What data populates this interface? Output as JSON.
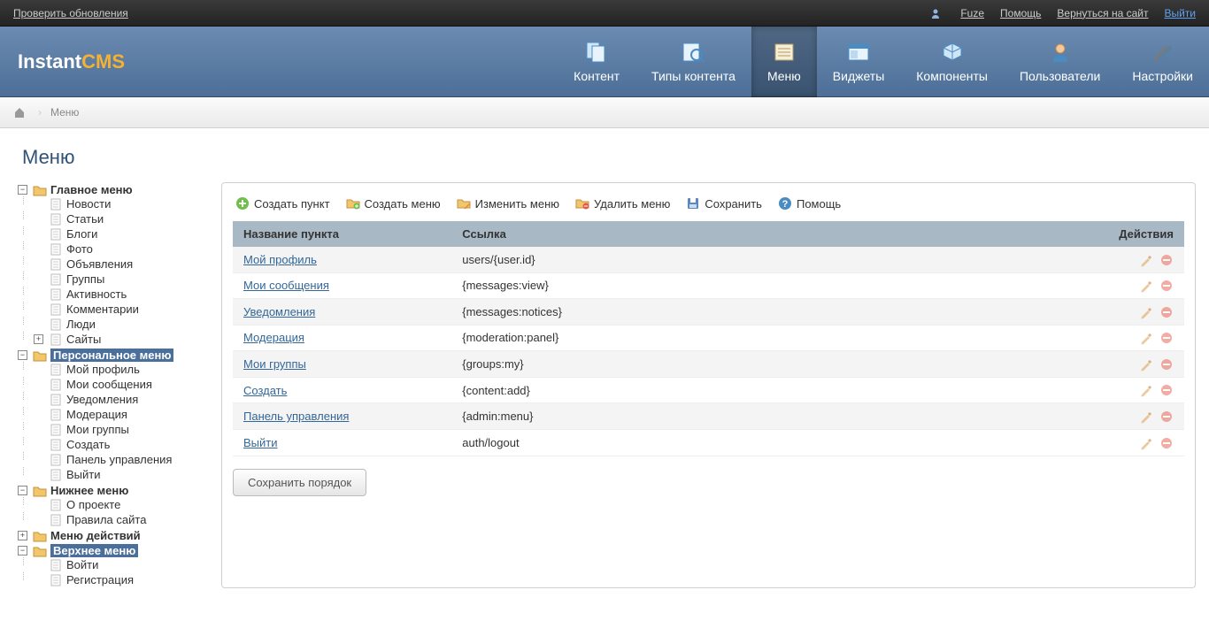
{
  "topbar": {
    "check_updates": "Проверить обновления",
    "user": "Fuze",
    "help": "Помощь",
    "back_to_site": "Вернуться на сайт",
    "logout": "Выйти"
  },
  "logo": {
    "part1": "Instant",
    "part2": "CMS"
  },
  "nav": {
    "content": "Контент",
    "content_types": "Типы контента",
    "menu": "Меню",
    "widgets": "Виджеты",
    "components": "Компоненты",
    "users": "Пользователи",
    "settings": "Настройки"
  },
  "breadcrumb": {
    "current": "Меню"
  },
  "page_title": "Меню",
  "tree": [
    {
      "type": "folder",
      "label": "Главное меню",
      "open": true,
      "children": [
        {
          "label": "Новости"
        },
        {
          "label": "Статьи"
        },
        {
          "label": "Блоги"
        },
        {
          "label": "Фото"
        },
        {
          "label": "Объявления"
        },
        {
          "label": "Группы"
        },
        {
          "label": "Активность"
        },
        {
          "label": "Комментарии"
        },
        {
          "label": "Люди"
        },
        {
          "label": "Сайты",
          "expandable": true
        }
      ]
    },
    {
      "type": "folder",
      "label": "Персональное меню",
      "open": true,
      "selected": true,
      "children": [
        {
          "label": "Мой профиль"
        },
        {
          "label": "Мои сообщения"
        },
        {
          "label": "Уведомления"
        },
        {
          "label": "Модерация"
        },
        {
          "label": "Мои группы"
        },
        {
          "label": "Создать"
        },
        {
          "label": "Панель управления"
        },
        {
          "label": "Выйти"
        }
      ]
    },
    {
      "type": "folder",
      "label": "Нижнее меню",
      "open": true,
      "children": [
        {
          "label": "О проекте"
        },
        {
          "label": "Правила сайта"
        }
      ]
    },
    {
      "type": "folder",
      "label": "Меню действий",
      "open": false,
      "children": []
    },
    {
      "type": "folder",
      "label": "Верхнее меню",
      "open": true,
      "selected": true,
      "children": [
        {
          "label": "Войти"
        },
        {
          "label": "Регистрация"
        }
      ]
    }
  ],
  "toolbar": {
    "create_item": "Создать пункт",
    "create_menu": "Создать меню",
    "edit_menu": "Изменить меню",
    "delete_menu": "Удалить меню",
    "save": "Сохранить",
    "help": "Помощь"
  },
  "table": {
    "headers": {
      "title": "Название пункта",
      "link": "Ссылка",
      "actions": "Действия"
    },
    "rows": [
      {
        "title": "Мой профиль",
        "link": "users/{user.id}"
      },
      {
        "title": "Мои сообщения",
        "link": "{messages:view}"
      },
      {
        "title": "Уведомления",
        "link": "{messages:notices}"
      },
      {
        "title": "Модерация",
        "link": "{moderation:panel}"
      },
      {
        "title": "Мои группы",
        "link": "{groups:my}"
      },
      {
        "title": "Создать",
        "link": "{content:add}"
      },
      {
        "title": "Панель управления",
        "link": "{admin:menu}"
      },
      {
        "title": "Выйти",
        "link": "auth/logout"
      }
    ]
  },
  "save_order": "Сохранить порядок"
}
